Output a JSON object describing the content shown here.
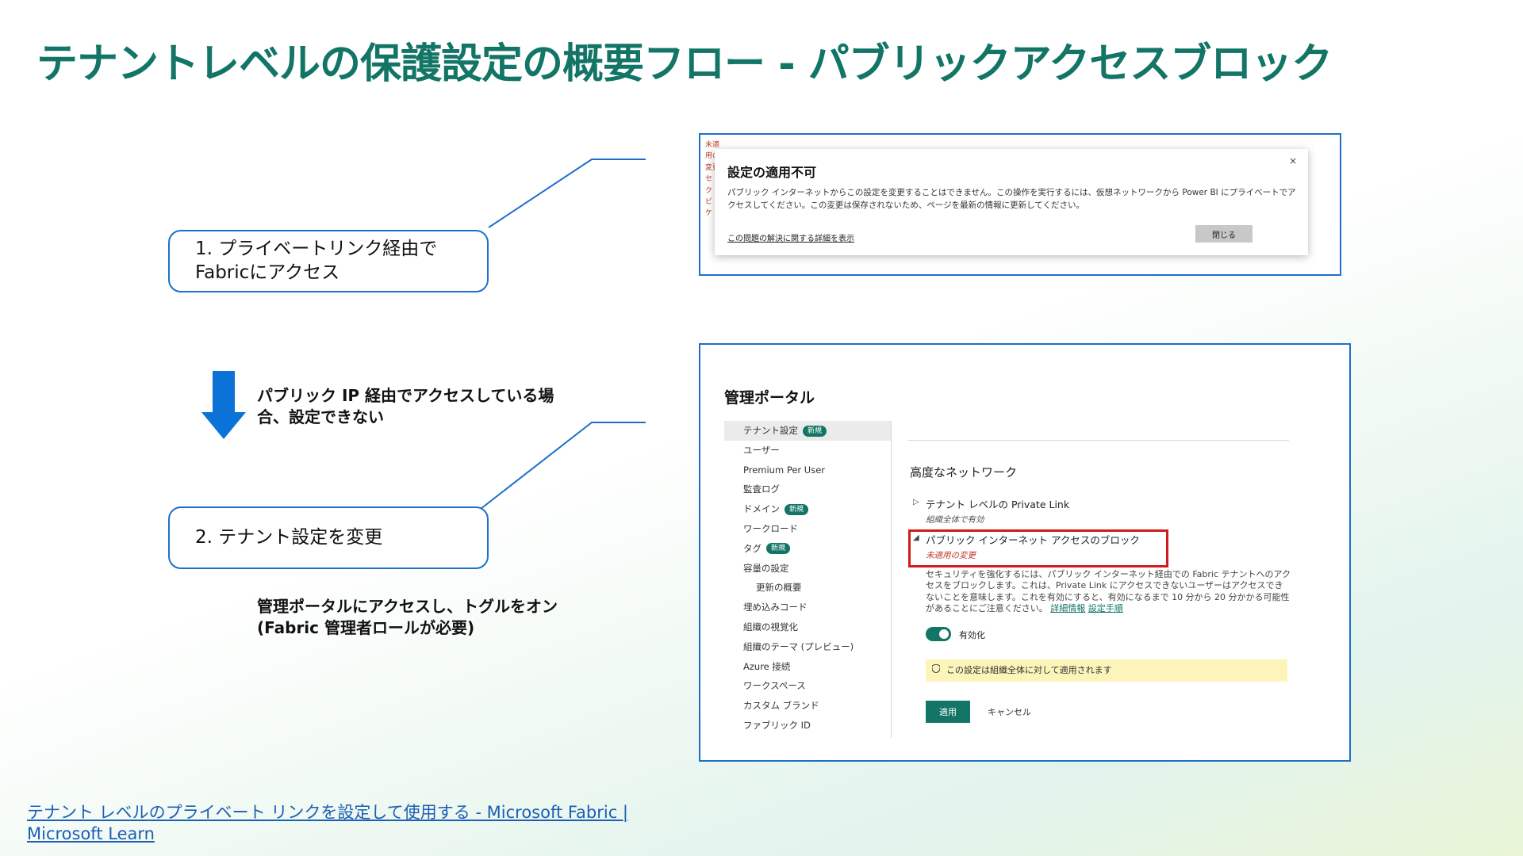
{
  "slide": {
    "title": "テナントレベルの保護設定の概要フロー - パブリックアクセスブロック",
    "step1": {
      "line1": "1. プライベートリンク経由で",
      "line2": "Fabricにアクセス"
    },
    "note1": {
      "line1": "パブリック IP 経由でアクセスしている場",
      "line2": "合、設定できない"
    },
    "step2": {
      "label": "2. テナント設定を変更"
    },
    "note2": {
      "line1": "管理ポータルにアクセスし、トグルをオン",
      "line2": "(Fabric 管理者ロールが必要)"
    },
    "footer": {
      "line1": "テナント レベルのプライベート リンクを設定して使用する - Microsoft Fabric |",
      "line2": "Microsoft Learn"
    }
  },
  "dialog": {
    "peek_text": "未適用の変更 セ ク ビ ケ",
    "title": "設定の適用不可",
    "body": "パブリック インターネットからこの設定を変更することはできません。この操作を実行するには、仮想ネットワークから Power BI にプライベートでアクセスしてください。この変更は保存されないため、ページを最新の情報に更新してください。",
    "help_link": "この問題の解決に関する詳細を表示",
    "close_label": "閉じる",
    "close_icon": "×"
  },
  "portal": {
    "title": "管理ポータル",
    "nav": [
      {
        "label": "テナント設定",
        "badge": "新規"
      },
      {
        "label": "ユーザー"
      },
      {
        "label": "Premium Per User"
      },
      {
        "label": "監査ログ"
      },
      {
        "label": "ドメイン",
        "badge": "新規"
      },
      {
        "label": "ワークロード"
      },
      {
        "label": "タグ",
        "badge": "新規"
      },
      {
        "label": "容量の設定"
      },
      {
        "label": "更新の概要"
      },
      {
        "label": "埋め込みコード"
      },
      {
        "label": "組織の視覚化"
      },
      {
        "label": "組織のテーマ (プレビュー)"
      },
      {
        "label": "Azure 接続"
      },
      {
        "label": "ワークスペース"
      },
      {
        "label": "カスタム ブランド"
      },
      {
        "label": "ファブリック ID"
      }
    ],
    "section_title": "高度なネットワーク",
    "setting1": {
      "name": "テナント レベルの Private Link",
      "sub": "組織全体で有効"
    },
    "setting2": {
      "name": "パブリック インターネット アクセスのブロック",
      "sub": "未適用の変更"
    },
    "description": "セキュリティを強化するには、パブリック インターネット経由での Fabric テナントへのアクセスをブロックします。これは、Private Link にアクセスできないユーザーはアクセスできないことを意味します。これを有効にすると、有効になるまで 10 分から 20 分かかる可能性があることにご注意ください。",
    "link_details": "詳細情報",
    "link_steps": "設定手順",
    "toggle_label": "有効化",
    "info_text": "この設定は組織全体に対して適用されます",
    "apply_label": "適用",
    "cancel_label": "キャンセル"
  },
  "colors": {
    "title_green": "#127566",
    "callout_blue": "#1f6fc9",
    "arrow_blue": "#0b72d8",
    "highlight_red": "#d11a1a",
    "link_blue": "#1a5fb4"
  }
}
